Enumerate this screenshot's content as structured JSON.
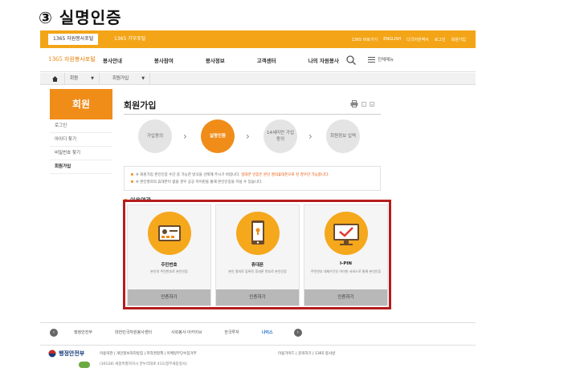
{
  "heading": "③ 실명인증",
  "topbar": {
    "tabs": [
      "1365 자원봉사포털",
      "1365 기부포털"
    ],
    "util_links": [
      "1365 바로가기",
      "ENGLISH",
      "다국어번역서",
      "로그인",
      "회원가입"
    ]
  },
  "header": {
    "logo": "1365 자원봉사포털",
    "nav": [
      "봉사안내",
      "봉사참여",
      "봉사정보",
      "고객센터",
      "나의 자원봉사"
    ],
    "menu_label": "전체메뉴"
  },
  "breadcrumb": {
    "items": [
      "회원",
      "회원가입"
    ]
  },
  "sidebar": {
    "title": "회원",
    "items": [
      "로그인",
      "아이디 찾기",
      "비밀번호 찾기",
      "회원가입"
    ]
  },
  "main": {
    "title": "회원가입",
    "steps": [
      {
        "label": "가입동의"
      },
      {
        "label": "실명인증"
      },
      {
        "label": "14세미만 가입동의"
      },
      {
        "label": "회원정보 입력"
      }
    ],
    "notice": [
      {
        "text": "※ 회원가입 본인인증 수단 중 가능한 방식을 선택해 주시기 바랍니다.",
        "highlight": " 일대폰 인증은 본인 명의휴대폰으로 된 경우만 가능합니다."
      },
      {
        "text": "※ 본인명의의 휴대폰이 없을 경우 공공 아이핀을 통해 본인인증을 하실 수 있습니다.",
        "highlight": ""
      }
    ],
    "section_title": "이용약관",
    "auth_options": [
      {
        "name": "주민번호",
        "desc": "본인의 주민번호로 본인인증",
        "button": "인증하기"
      },
      {
        "name": "휴대폰",
        "desc": "본인 명의로 등록된 휴대폰 번호로 본인인증",
        "button": "인증하기"
      },
      {
        "name": "I-PIN",
        "desc": "주민번호 대체수단인 아이핀 서비스로 통해 본인인증",
        "button": "인증하기"
      }
    ]
  },
  "footer": {
    "partner_logos": [
      "행정안전부",
      "대한민국자원봉사센터",
      "사회봉사·아카이브",
      "한국투자",
      "나이스"
    ],
    "org_name": "행정안전부",
    "links": "이용약관 | 개인정보처리방침 | 저작권정책 | 이메일무단수집거부",
    "checks": "이용가이드 | 문의하기 | 1365 봉사방",
    "address": "(30128) 세종특별자치시 한누리대로 411(정부세종청사)"
  },
  "colors": {
    "accent": "#f08c18",
    "topbar": "#f3a517",
    "frame": "#b71c1c",
    "icon_circle": "#f5a81c"
  }
}
